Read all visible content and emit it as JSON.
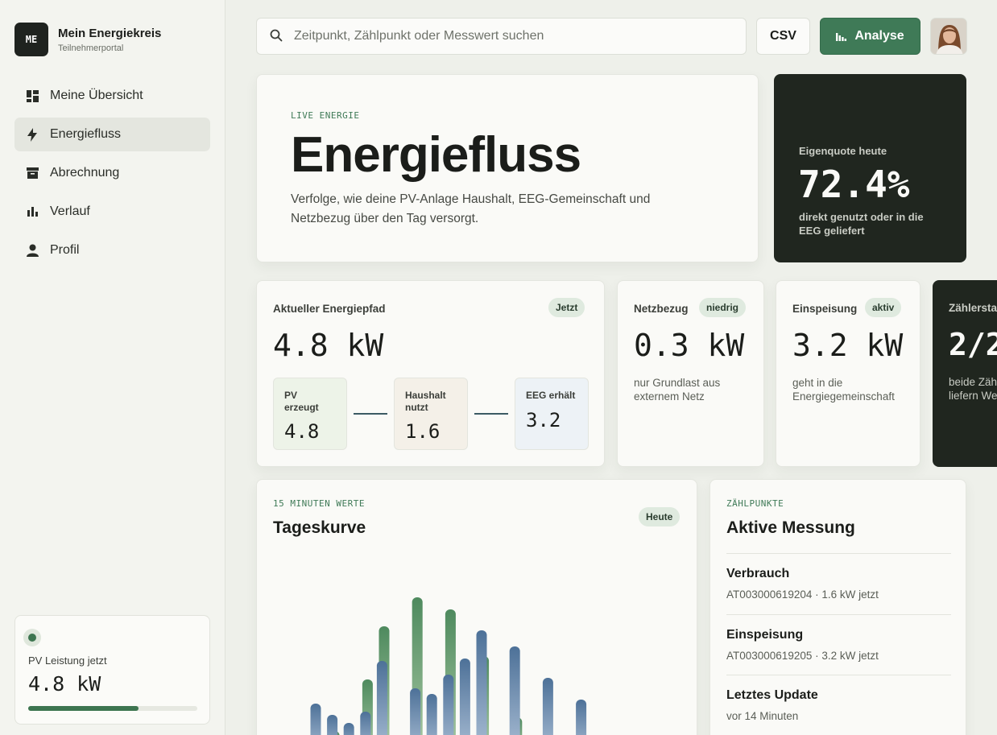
{
  "brand": {
    "logo": "ME",
    "title": "Mein Energiekreis",
    "subtitle": "Teilnehmerportal"
  },
  "nav": [
    {
      "label": "Meine Übersicht",
      "icon": "dashboard-icon"
    },
    {
      "label": "Energiefluss",
      "icon": "bolt-icon",
      "active": true
    },
    {
      "label": "Abrechnung",
      "icon": "archive-icon"
    },
    {
      "label": "Verlauf",
      "icon": "bar-chart-icon"
    },
    {
      "label": "Profil",
      "icon": "user-icon"
    }
  ],
  "pv_card": {
    "label": "PV Leistung jetzt",
    "value": "4.8 kW",
    "progress": 0.65
  },
  "search": {
    "placeholder": "Zeitpunkt, Zählpunkt oder Messwert suchen"
  },
  "toolbar": {
    "csv_label": "CSV",
    "analyse_label": "Analyse"
  },
  "hero": {
    "eyebrow": "LIVE ENERGIE",
    "title": "Energiefluss",
    "description": "Verfolge, wie deine PV-Anlage Haushalt, EEG-Gemeinschaft und Netzbezug über den Tag versorgt."
  },
  "quote": {
    "label": "Eigenquote heute",
    "value": "72.4%",
    "description": "direkt genutzt oder in die EEG geliefert"
  },
  "path_card": {
    "title": "Aktueller Energiepfad",
    "badge": "Jetzt",
    "value": "4.8 kW",
    "nodes": [
      {
        "label": "PV erzeugt",
        "value": "4.8"
      },
      {
        "label": "Haushalt nutzt",
        "value": "1.6"
      },
      {
        "label": "EEG erhält",
        "value": "3.2"
      }
    ]
  },
  "netz_card": {
    "title": "Netzbezug",
    "badge": "niedrig",
    "value": "0.3 kW",
    "description": "nur Grundlast aus externem Netz"
  },
  "einsp_card": {
    "title": "Einspeisung",
    "badge": "aktiv",
    "value": "3.2 kW",
    "description": "geht in die Energiegemeinschaft"
  },
  "zaehl_card": {
    "title": "Zählersta",
    "value": "2/2",
    "description_line1": "beide Zähl",
    "description_line2": "liefern We"
  },
  "chart_card": {
    "eyebrow": "15 MINUTEN WERTE",
    "title": "Tageskurve",
    "badge": "Heute"
  },
  "chart_data": {
    "type": "bar",
    "colors": {
      "green": "#4e8a5e",
      "blue": "#5a7fa6"
    },
    "series": [
      {
        "values": [
          null,
          null,
          0.28,
          null,
          0.92,
          1.58,
          null,
          1.94,
          null,
          1.79,
          null,
          1.21,
          null,
          0.45,
          null,
          null,
          null,
          null,
          null
        ]
      },
      {
        "values": [
          0.62,
          0.48,
          0.38,
          0.52,
          1.15,
          null,
          0.81,
          0.74,
          0.98,
          1.18,
          1.53,
          null,
          1.33,
          null,
          0.94,
          null,
          0.67,
          null,
          null
        ]
      }
    ]
  },
  "mess_card": {
    "eyebrow": "ZÄHLPUNKTE",
    "title": "Aktive Messung",
    "rows": [
      {
        "title": "Verbrauch",
        "sub": "AT003000619204 · 1.6 kW jetzt"
      },
      {
        "title": "Einspeisung",
        "sub": "AT003000619205 · 3.2 kW jetzt"
      },
      {
        "title": "Letztes Update",
        "sub": "vor 14 Minuten"
      }
    ]
  }
}
